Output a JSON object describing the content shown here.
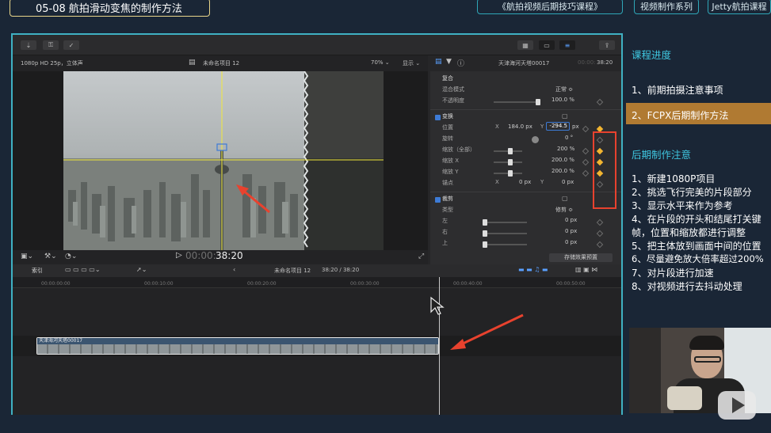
{
  "header": {
    "lesson_title": "05-08 航拍滑动变焦的制作方法",
    "series_title": "《航拍视频后期技巧课程》",
    "series_tag": "视频制作系列",
    "brand_tag": "Jetty航拍课程"
  },
  "viewer": {
    "format": "1080p HD 25p，立体声",
    "project_name": "未命名项目 12",
    "zoom": "70%",
    "display_menu": "显示",
    "timecode_dim": "00:00:",
    "timecode": "38:20"
  },
  "inspector": {
    "clip_name": "天津海河天塔00017",
    "clip_time": "38:20",
    "clip_time_dim": "00:00:",
    "composite": {
      "section": "复合",
      "blend_label": "混合模式",
      "blend_value": "正常 ≎",
      "opacity_label": "不透明度",
      "opacity_value": "100.0 %",
      "opacity_level": 1.0
    },
    "transform": {
      "section": "变换",
      "position_label": "位置",
      "x_label": "X",
      "x_value": "184.0 px",
      "y_label": "Y",
      "y_value": "-294.5",
      "y_unit": "px",
      "rotation_label": "旋转",
      "rotation_value": "0 °",
      "scale_all_label": "缩放（全部）",
      "scale_all_value": "200 %",
      "scale_x_label": "缩放 X",
      "scale_x_value": "200.0 %",
      "scale_y_label": "缩放 Y",
      "scale_y_value": "200.0 %",
      "scale_level": 0.5,
      "anchor_label": "锚点",
      "anchor_x_label": "X",
      "anchor_x_value": "0 px",
      "anchor_y_label": "Y",
      "anchor_y_value": "0 px"
    },
    "crop": {
      "section": "裁剪",
      "type_label": "类型",
      "type_value": "修剪 ≎",
      "left_label": "左",
      "left_value": "0 px",
      "right_label": "右",
      "right_value": "0 px",
      "top_label": "上",
      "top_value": "0 px"
    },
    "save_preset": "存储效果预置"
  },
  "timeline": {
    "index_label": "索引",
    "project_name": "未命名项目 12",
    "duration": "38:20 / 38:20",
    "ruler": [
      "00:00:00:00",
      "00:00:10:00",
      "00:00:20:00",
      "00:00:30:00",
      "00:00:40:00",
      "00:00:50:00"
    ],
    "clip_name": "天津海河天塔00017"
  },
  "sidebar": {
    "progress_heading": "课程进度",
    "progress_items": [
      "1、前期拍摄注意事项",
      "2、FCPX后期制作方法"
    ],
    "active_item": 1,
    "notes_heading": "后期制作注意",
    "notes": [
      "1、新建1080P项目",
      "2、挑选飞行完美的片段部分",
      "3、显示水平来作为参考",
      "4、在片段的开头和结尾打关键",
      "帧，位置和缩放都进行调整",
      "5、把主体放到画面中间的位置",
      "6、尽量避免放大倍率超过200%",
      "7、对片段进行加速",
      "8、对视频进行去抖动处理"
    ]
  },
  "colors": {
    "accent": "#3fb1c3",
    "keyframe": "#f2b530",
    "active_progress": "#b07a32",
    "annotation": "#e8422e"
  },
  "icons": [
    "import-icon",
    "key-icon",
    "checkmark-icon",
    "share-icon",
    "play-icon",
    "fullscreen-icon",
    "film-icon",
    "filter-icon",
    "info-icon",
    "select-arrow-icon",
    "chevron-left-icon",
    "mouse-cursor-icon",
    "red-arrow-annotation-icon",
    "bilibili-logo-icon"
  ]
}
